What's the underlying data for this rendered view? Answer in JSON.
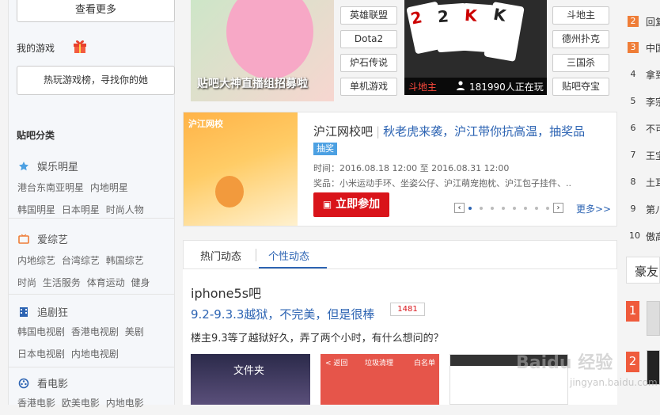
{
  "sidebar": {
    "view_more": "查看更多",
    "my_games": "我的游戏",
    "rank_button": "热玩游戏榜，寻找你的她",
    "category_title": "贴吧分类",
    "categories": [
      {
        "label": "娱乐明星",
        "icon": "star-icon",
        "links": [
          "港台东南亚明星",
          "内地明星",
          "韩国明星",
          "日本明星",
          "时尚人物"
        ]
      },
      {
        "label": "爱综艺",
        "icon": "tv-icon",
        "links": [
          "内地综艺",
          "台湾综艺",
          "韩国综艺",
          "时尚",
          "生活服务",
          "体育运动",
          "健身"
        ]
      },
      {
        "label": "追剧狂",
        "icon": "film-icon",
        "links": [
          "韩国电视剧",
          "香港电视剧",
          "美剧",
          "日本电视剧",
          "内地电视剧"
        ]
      },
      {
        "label": "看电影",
        "icon": "reel-icon",
        "links": [
          "香港电影",
          "欧美电影",
          "内地电影"
        ]
      }
    ]
  },
  "banner": {
    "caption": "贴吧大神直播组招募啦",
    "game_tags": [
      "英雄联盟",
      "Dota2",
      "炉石传说",
      "单机游戏"
    ],
    "card_tags": [
      "斗地主",
      "德州扑克",
      "三国杀",
      "贴吧夺宝"
    ],
    "cards_game": "斗地主",
    "players_online": "181990人正在玩"
  },
  "promo": {
    "logo": "沪江网校",
    "bar_name": "沪江网校吧",
    "title": "秋老虎来袭，沪江带你抗高温，抽奖品",
    "tag": "抽奖",
    "time_label": "时间：",
    "time_value": "2016.08.18 12:00 至 2016.08.31 12:00",
    "prize_label": "奖品：",
    "prize_value": "小米运动手环、坐姿公仔、沪江萌宠抱枕、沪江包子挂件、..",
    "join_button": "立即参加",
    "more": "更多>>"
  },
  "tabs": {
    "hot": "热门动态",
    "personal": "个性动态"
  },
  "post": {
    "bar_name": "iphone5s吧",
    "title": "9.2-9.3.3越狱，不完美，但是很棒",
    "reply_count": "1481",
    "body": "楼主9.3等了越狱好久，弄了两个小时，有什么想问的？",
    "thumb1_text": "文件夹",
    "thumb2_back": "< 返回",
    "thumb2_title": "垃圾清理",
    "thumb2_right": "白名单"
  },
  "right_ranking": [
    {
      "rank": "2",
      "text": "回复",
      "hot": true
    },
    {
      "rank": "3",
      "text": "中国",
      "hot": true
    },
    {
      "rank": "4",
      "text": "拿到",
      "hot": false
    },
    {
      "rank": "5",
      "text": "李宗",
      "hot": false
    },
    {
      "rank": "6",
      "text": "不可",
      "hot": false
    },
    {
      "rank": "7",
      "text": "王宝",
      "hot": false
    },
    {
      "rank": "8",
      "text": "土耳",
      "hot": false
    },
    {
      "rank": "9",
      "text": "第八",
      "hot": false
    },
    {
      "rank": "10",
      "text": "傲高",
      "hot": false
    }
  ],
  "right_box_title": "豪友",
  "watermark": {
    "main": "Baidu 经验",
    "sub": "jingyan.baidu.com"
  },
  "colors": {
    "link": "#2d64b3",
    "join": "#d9141a",
    "hot_rank": "#ef7d37"
  }
}
